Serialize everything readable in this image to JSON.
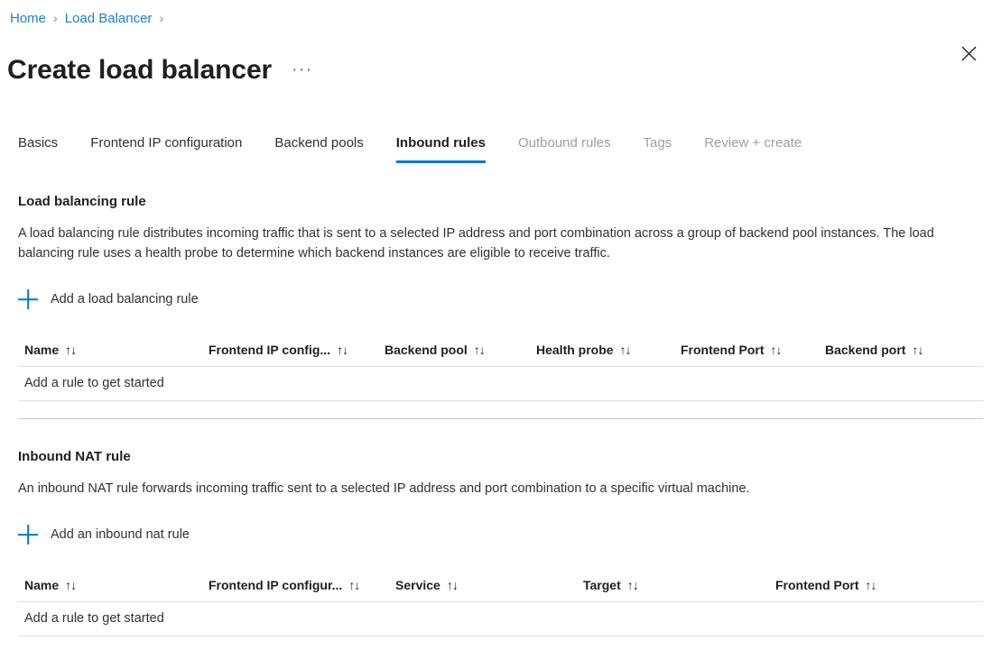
{
  "breadcrumb": {
    "items": [
      {
        "label": "Home"
      },
      {
        "label": "Load Balancer"
      }
    ],
    "separator": "›"
  },
  "header": {
    "title": "Create load balancer",
    "more_actions": "···",
    "close_icon": "close-icon"
  },
  "tabs": [
    {
      "label": "Basics",
      "state": "enabled"
    },
    {
      "label": "Frontend IP configuration",
      "state": "enabled"
    },
    {
      "label": "Backend pools",
      "state": "enabled"
    },
    {
      "label": "Inbound rules",
      "state": "active"
    },
    {
      "label": "Outbound rules",
      "state": "disabled"
    },
    {
      "label": "Tags",
      "state": "disabled"
    },
    {
      "label": "Review + create",
      "state": "disabled"
    }
  ],
  "load_balancing_rule": {
    "title": "Load balancing rule",
    "description": "A load balancing rule distributes incoming traffic that is sent to a selected IP address and port combination across a group of backend pool instances. The load balancing rule uses a health probe to determine which backend instances are eligible to receive traffic.",
    "add_label": "Add a load balancing rule",
    "add_icon": "plus-icon",
    "columns": [
      {
        "label": "Name",
        "sort": "↑↓"
      },
      {
        "label": "Frontend IP config...",
        "sort": "↑↓"
      },
      {
        "label": "Backend pool",
        "sort": "↑↓"
      },
      {
        "label": "Health probe",
        "sort": "↑↓"
      },
      {
        "label": "Frontend Port",
        "sort": "↑↓"
      },
      {
        "label": "Backend port",
        "sort": "↑↓"
      }
    ],
    "empty_message": "Add a rule to get started",
    "rows": []
  },
  "inbound_nat_rule": {
    "title": "Inbound NAT rule",
    "description": "An inbound NAT rule forwards incoming traffic sent to a selected IP address and port combination to a specific virtual machine.",
    "add_label": "Add an inbound nat rule",
    "add_icon": "plus-icon",
    "columns": [
      {
        "label": "Name",
        "sort": "↑↓"
      },
      {
        "label": "Frontend IP configur...",
        "sort": "↑↓"
      },
      {
        "label": "Service",
        "sort": "↑↓"
      },
      {
        "label": "Target",
        "sort": "↑↓"
      },
      {
        "label": "Frontend Port",
        "sort": "↑↓"
      }
    ],
    "empty_message": "Add a rule to get started",
    "rows": []
  },
  "colors": {
    "accent": "#0078d4",
    "link": "#1a7fd4",
    "text": "#323130",
    "disabled_text": "#a19f9d",
    "divider": "#e1dfdd",
    "section_divider": "#c8c6c4"
  }
}
